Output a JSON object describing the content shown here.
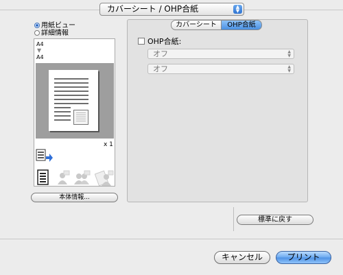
{
  "panel_popup": {
    "value": "カバーシート / OHP合紙"
  },
  "preview_mode": {
    "options": [
      {
        "label": "用紙ビュー",
        "selected": true
      },
      {
        "label": "詳細情報",
        "selected": false
      }
    ]
  },
  "preview": {
    "source_size": "A4",
    "arrow": "▼",
    "dest_size": "A4",
    "copies": "x 1"
  },
  "icons": [
    "paper-feed-icon",
    "document-icon",
    "single-user-icon",
    "group-user-icon",
    "secure-user-icon"
  ],
  "device_info_button": "本体情報...",
  "tabs": [
    {
      "label": "カバーシート",
      "selected": false
    },
    {
      "label": "OHP合紙",
      "selected": true
    }
  ],
  "ohp": {
    "checkbox_label": "OHP合紙:",
    "checked": false,
    "popup1_value": "オフ",
    "popup2_value": "オフ"
  },
  "restore_defaults_button": "標準に戻す",
  "cancel_button": "キャンセル",
  "print_button": "プリント"
}
